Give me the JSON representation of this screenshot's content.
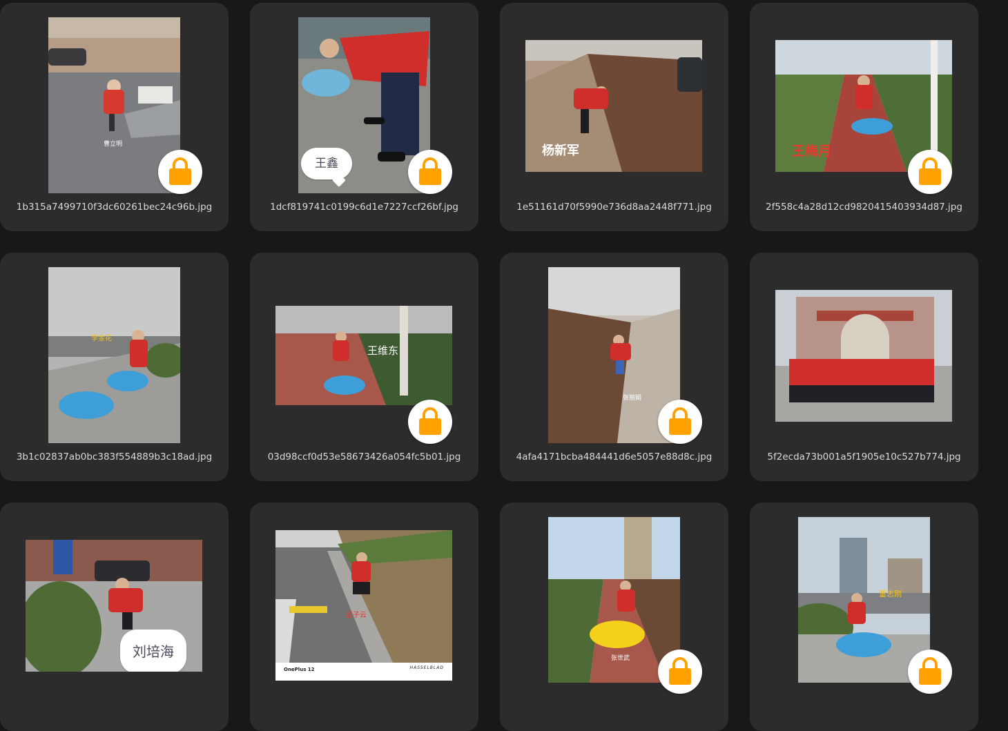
{
  "files": [
    {
      "name": "1b315a7499710f3dc60261bec24c96b.jpg",
      "label": "曹立明",
      "label_color": "#ffffff",
      "locked": true
    },
    {
      "name": "1dcf819741c0199c6d1e7227ccf26bf.jpg",
      "label": "王鑫",
      "label_color": "#4a4a5a",
      "locked": true
    },
    {
      "name": "1e51161d70f5990e736d8aa2448f771.jpg",
      "label": "杨新军",
      "label_color": "#ffffff",
      "locked": false
    },
    {
      "name": "2f558c4a28d12cd9820415403934d87.jpg",
      "label": "王梅月",
      "label_color": "#e8382e",
      "locked": true
    },
    {
      "name": "3b1c02837ab0bc383f554889b3c18ad.jpg",
      "label": "李金花",
      "label_color": "#f0c419",
      "locked": false
    },
    {
      "name": "03d98ccf0d53e58673426a054fc5b01.jpg",
      "label": "王维东",
      "label_color": "#ffffff",
      "locked": true
    },
    {
      "name": "4afa4171bcba484441d6e5057e88d8c.jpg",
      "label": "张丽娟",
      "label_color": "#ffffff",
      "locked": true
    },
    {
      "name": "5f2ecda73b001a5f1905e10c527b774.jpg",
      "label": "",
      "label_color": "#ffffff",
      "locked": false
    },
    {
      "name": "",
      "label": "刘培海",
      "label_color": "#4a4a5a",
      "locked": false
    },
    {
      "name": "",
      "label": "孟子云",
      "label_color": "#e8382e",
      "locked": false,
      "footer_left": "OnePlus 12",
      "footer_right": "HASSELBLAD"
    },
    {
      "name": "",
      "label": "张世武",
      "label_color": "#ffffff",
      "locked": true
    },
    {
      "name": "",
      "label": "董志刚",
      "label_color": "#f0c419",
      "locked": true
    }
  ],
  "colors": {
    "background": "#181818",
    "card": "#2c2c2c",
    "lock_accent": "#ffa200",
    "text": "#d9d9d9"
  },
  "icons": {
    "lock": "lock-icon"
  }
}
